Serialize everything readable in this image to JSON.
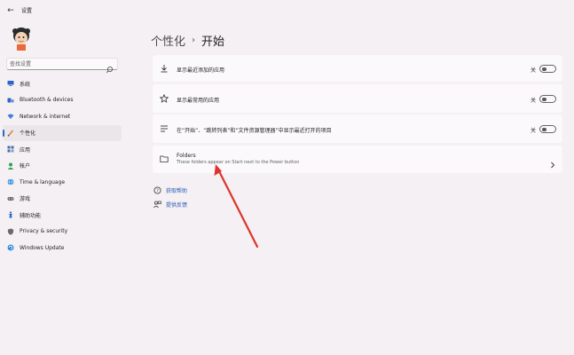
{
  "titlebar": {
    "back_glyph": "←",
    "title": "设置"
  },
  "search": {
    "placeholder": "查找设置"
  },
  "sidebar": {
    "items": [
      {
        "label": "系统",
        "icon": "monitor-icon",
        "color": "#2b66c7"
      },
      {
        "label": "Bluetooth & devices",
        "icon": "bluetooth-icon",
        "color": "#2b66c7"
      },
      {
        "label": "Network & internet",
        "icon": "wifi-icon",
        "color": "#3c7fe0"
      },
      {
        "label": "个性化",
        "icon": "brush-icon",
        "color": "#d9822b",
        "active": true
      },
      {
        "label": "应用",
        "icon": "apps-icon",
        "color": "#4a6fa5"
      },
      {
        "label": "帐户",
        "icon": "person-icon",
        "color": "#2fa14f"
      },
      {
        "label": "Time & language",
        "icon": "globe-icon",
        "color": "#2b8ad8"
      },
      {
        "label": "游戏",
        "icon": "gamepad-icon",
        "color": "#6b6b6b"
      },
      {
        "label": "辅助功能",
        "icon": "accessibility-icon",
        "color": "#2b66c7"
      },
      {
        "label": "Privacy & security",
        "icon": "shield-icon",
        "color": "#6b6b6b"
      },
      {
        "label": "Windows Update",
        "icon": "update-icon",
        "color": "#2b88d8"
      }
    ]
  },
  "breadcrumb": {
    "parent": "个性化",
    "separator": "›",
    "current": "开始"
  },
  "settings": {
    "recent_apps": {
      "label": "显示最近添加的应用",
      "state": "关"
    },
    "most_used": {
      "label": "显示最常用的应用",
      "state": "关"
    },
    "recent_items": {
      "label": "在“开始”、“跳转列表”和“文件资源管理器”中显示最近打开的项目",
      "state": "关"
    },
    "folders": {
      "title": "Folders",
      "description": "These folders appear on Start next to the Power button"
    }
  },
  "links": {
    "help": "获取帮助",
    "feedback": "提供反馈"
  },
  "colors": {
    "accent": "#2b66c7",
    "annotation_arrow": "#e0332b"
  }
}
